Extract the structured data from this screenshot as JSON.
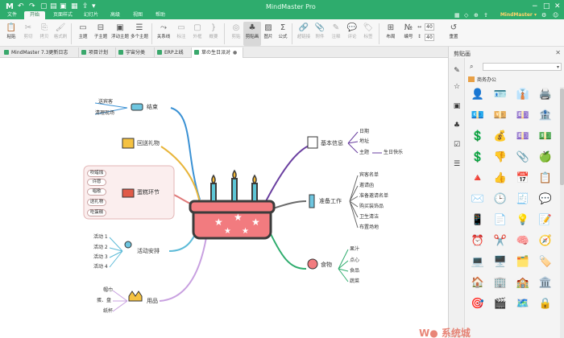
{
  "app": {
    "title": "MindMaster Pro",
    "brand": "MindMaster ▾"
  },
  "menu": [
    "文件",
    "开始",
    "页面样式",
    "幻灯片",
    "高级",
    "视图",
    "帮助"
  ],
  "ribbon": {
    "buttons": [
      "粘贴",
      "剪切",
      "拷贝",
      "格式刷",
      "主题",
      "子主题",
      "浮动主题",
      "多个主题",
      "关系线",
      "标注",
      "外框",
      "概要",
      "剪贴",
      "剪贴画",
      "图片",
      "公式",
      "超链接",
      "附件",
      "注释",
      "评论",
      "标签",
      "布局",
      "编号",
      "重置"
    ],
    "spin1": "40",
    "spin2": "40"
  },
  "tabs": [
    {
      "label": "MindMaster 7.3更新日志"
    },
    {
      "label": "项目计划"
    },
    {
      "label": "宇宙分类"
    },
    {
      "label": "ERP上线"
    },
    {
      "label": "草の生日派对",
      "close": "●"
    }
  ],
  "map": {
    "branches": [
      {
        "label": "结束",
        "children": [
          "送宾客",
          "清理现场"
        ]
      },
      {
        "label": "回送礼物",
        "children": []
      },
      {
        "label": "蛋糕环节",
        "children": [
          "吹蜡烛",
          "许愿",
          "唱歌",
          "送礼物",
          "吃蛋糕"
        ]
      },
      {
        "label": "活动安排",
        "children": [
          "活动 1",
          "活动 2",
          "活动 3",
          "活动 4"
        ]
      },
      {
        "label": "用品",
        "children": [
          "帽巾",
          "蛋、盘",
          "纸杯"
        ]
      },
      {
        "label": "基本信息",
        "children": [
          "日期",
          "地址",
          "主题"
        ],
        "extra": "生日快乐"
      },
      {
        "label": "准备工作",
        "children": [
          "宾客名单",
          "邀请函",
          "准备邀请名单",
          "购买装饰品",
          "卫生清洁",
          "布置场地"
        ]
      },
      {
        "label": "食物",
        "children": [
          "果汁",
          "点心",
          "食品",
          "蔬菜"
        ]
      }
    ]
  },
  "panel": {
    "title": "剪贴画",
    "close": "✕",
    "category": "商务办公",
    "clipart": [
      "👤",
      "🪪",
      "👔",
      "🖨️",
      "💶",
      "💴",
      "💷",
      "🏦",
      "💲",
      "💰",
      "💷",
      "💵",
      "💲",
      "👎",
      "📎",
      "🍏",
      "🔺",
      "👍",
      "📅",
      "📋",
      "✉️",
      "🕒",
      "🧾",
      "💬",
      "📱",
      "📄",
      "💡",
      "📝",
      "⏰",
      "✂️",
      "🧠",
      "🧭",
      "💻",
      "🖥️",
      "🗂️",
      "🏷️",
      "🏠",
      "🏢",
      "🏫",
      "🏛️",
      "🎯",
      "🎬",
      "🗺️",
      "🔒"
    ]
  }
}
